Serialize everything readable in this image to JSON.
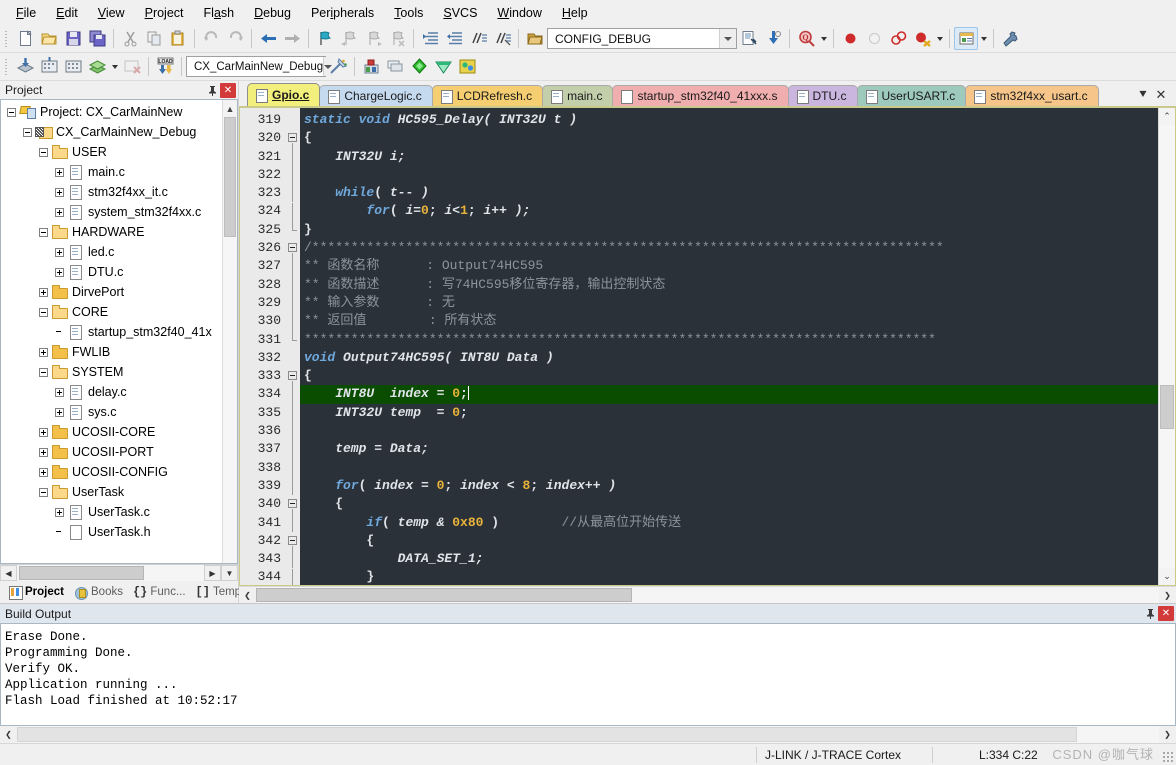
{
  "menubar": {
    "items": [
      {
        "label": "File",
        "accel": "F"
      },
      {
        "label": "Edit",
        "accel": "E"
      },
      {
        "label": "View",
        "accel": "V"
      },
      {
        "label": "Project",
        "accel": "P"
      },
      {
        "label": "Flash",
        "accel": "a"
      },
      {
        "label": "Debug",
        "accel": "D"
      },
      {
        "label": "Peripherals",
        "accel": "i"
      },
      {
        "label": "Tools",
        "accel": "T"
      },
      {
        "label": "SVCS",
        "accel": "S"
      },
      {
        "label": "Window",
        "accel": "W"
      },
      {
        "label": "Help",
        "accel": "H"
      }
    ]
  },
  "toolbar_main": {
    "config_value": "CONFIG_DEBUG",
    "icons": [
      "new-file-icon",
      "open-file-icon",
      "save-icon",
      "save-all-icon",
      "cut-icon",
      "copy-icon",
      "paste-icon",
      "undo-icon",
      "redo-icon",
      "navigate-back-icon",
      "navigate-forward-icon",
      "bookmark-toggle-icon",
      "bookmark-prev-icon",
      "bookmark-next-icon",
      "bookmark-clear-icon",
      "indent-icon",
      "outdent-icon",
      "comment-icon",
      "uncomment-icon",
      "open-config-icon",
      "build-target-file-icon",
      "download-icon",
      "find-in-files-icon",
      "insert-breakpoint-icon",
      "disable-breakpoint-icon",
      "kill-all-breakpoints-icon",
      "disable-all-breakpoints-icon",
      "manage-windows-icon",
      "configure-tools-icon"
    ]
  },
  "toolbar_build": {
    "target_value": "CX_CarMainNew_Debug",
    "icons": [
      "translate-icon",
      "build-icon",
      "rebuild-icon",
      "batch-build-icon",
      "stop-build-icon",
      "download-load-icon",
      "target-options-icon",
      "manage-project-items-icon",
      "multi-project-icon",
      "pack-installer-icon",
      "cube-mx-icon"
    ]
  },
  "project_pane": {
    "title": "Project",
    "pin_icon": "pin-icon",
    "close_icon": "close-icon",
    "tree": [
      {
        "depth": 0,
        "label": "Project: CX_CarMainNew",
        "icon": "project-icon",
        "expander": "minus"
      },
      {
        "depth": 1,
        "label": "CX_CarMainNew_Debug",
        "icon": "target-icon",
        "expander": "minus"
      },
      {
        "depth": 2,
        "label": "USER",
        "icon": "folder-open-icon",
        "expander": "minus"
      },
      {
        "depth": 3,
        "label": "main.c",
        "icon": "file-icon",
        "expander": "plus"
      },
      {
        "depth": 3,
        "label": "stm32f4xx_it.c",
        "icon": "file-icon",
        "expander": "plus"
      },
      {
        "depth": 3,
        "label": "system_stm32f4xx.c",
        "icon": "file-icon",
        "expander": "plus"
      },
      {
        "depth": 2,
        "label": "HARDWARE",
        "icon": "folder-open-icon",
        "expander": "minus"
      },
      {
        "depth": 3,
        "label": "led.c",
        "icon": "file-icon",
        "expander": "plus"
      },
      {
        "depth": 3,
        "label": "DTU.c",
        "icon": "file-icon",
        "expander": "plus"
      },
      {
        "depth": 2,
        "label": "DirvePort",
        "icon": "folder-closed-icon",
        "expander": "plus"
      },
      {
        "depth": 2,
        "label": "CORE",
        "icon": "folder-open-icon",
        "expander": "minus"
      },
      {
        "depth": 3,
        "label": "startup_stm32f40_41x",
        "icon": "file-icon",
        "expander": "none"
      },
      {
        "depth": 2,
        "label": "FWLIB",
        "icon": "folder-closed-icon",
        "expander": "plus"
      },
      {
        "depth": 2,
        "label": "SYSTEM",
        "icon": "folder-open-icon",
        "expander": "minus"
      },
      {
        "depth": 3,
        "label": "delay.c",
        "icon": "file-icon",
        "expander": "plus"
      },
      {
        "depth": 3,
        "label": "sys.c",
        "icon": "file-icon",
        "expander": "plus"
      },
      {
        "depth": 2,
        "label": "UCOSII-CORE",
        "icon": "folder-closed-icon",
        "expander": "plus"
      },
      {
        "depth": 2,
        "label": "UCOSII-PORT",
        "icon": "folder-closed-icon",
        "expander": "plus"
      },
      {
        "depth": 2,
        "label": "UCOSII-CONFIG",
        "icon": "folder-closed-icon",
        "expander": "plus"
      },
      {
        "depth": 2,
        "label": "UserTask",
        "icon": "folder-open-icon",
        "expander": "minus"
      },
      {
        "depth": 3,
        "label": "UserTask.c",
        "icon": "file-icon",
        "expander": "plus"
      },
      {
        "depth": 3,
        "label": "UserTask.h",
        "icon": "file-blank-icon",
        "expander": "none"
      }
    ],
    "bottom_tabs": [
      {
        "label": "Project",
        "icon": "project-tab-icon",
        "selected": true
      },
      {
        "label": "Books",
        "icon": "books-tab-icon",
        "selected": false
      },
      {
        "label": "Func...",
        "icon": "functions-tab-icon",
        "selected": false
      },
      {
        "label": "Temp...",
        "icon": "templates-tab-icon",
        "selected": false
      }
    ]
  },
  "editor": {
    "tabs": [
      {
        "label": "Gpio.c",
        "color": "#f3ef7d",
        "selected": true,
        "icon": "file-icon"
      },
      {
        "label": "ChargeLogic.c",
        "color": "#c5d9ef",
        "selected": false,
        "icon": "file-icon"
      },
      {
        "label": "LCDRefresh.c",
        "color": "#f5ce72",
        "selected": false,
        "icon": "file-icon"
      },
      {
        "label": "main.c",
        "color": "#c3ceab",
        "selected": false,
        "icon": "file-icon"
      },
      {
        "label": "startup_stm32f40_41xxx.s",
        "color": "#f0aeae",
        "selected": false,
        "icon": "file-blank-icon"
      },
      {
        "label": "DTU.c",
        "color": "#cbb6e0",
        "selected": false,
        "icon": "file-icon"
      },
      {
        "label": "UserUSART.c",
        "color": "#9ec9bd",
        "selected": false,
        "icon": "file-icon"
      },
      {
        "label": "stm32f4xx_usart.c",
        "color": "#f5c58a",
        "selected": false,
        "icon": "file-icon"
      }
    ],
    "tab_overflow_icon": "tab-list-icon",
    "tab_close_icon": "close-icon",
    "first_line_number": 319,
    "highlighted_line": 334,
    "lines": [
      {
        "n": 319,
        "fold": "none",
        "tokens": [
          {
            "t": "static ",
            "c": "kw"
          },
          {
            "t": "void ",
            "c": "kw"
          },
          {
            "t": "HC595_Delay( ",
            "c": "fn"
          },
          {
            "t": "INT32U ",
            "c": "ty"
          },
          {
            "t": "t )",
            "c": "ty"
          }
        ]
      },
      {
        "n": 320,
        "fold": "start",
        "tokens": [
          {
            "t": "{",
            "c": "pl"
          }
        ]
      },
      {
        "n": 321,
        "fold": "bar",
        "tokens": [
          {
            "t": "    INT32U i;",
            "c": "ty"
          }
        ]
      },
      {
        "n": 322,
        "fold": "bar",
        "tokens": [
          {
            "t": "",
            "c": "pl"
          }
        ]
      },
      {
        "n": 323,
        "fold": "bar",
        "tokens": [
          {
            "t": "    ",
            "c": "pl"
          },
          {
            "t": "while",
            "c": "kw"
          },
          {
            "t": "( ",
            "c": "pl"
          },
          {
            "t": "t-- )",
            "c": "ty"
          }
        ]
      },
      {
        "n": 324,
        "fold": "bar",
        "tokens": [
          {
            "t": "        ",
            "c": "pl"
          },
          {
            "t": "for",
            "c": "kw"
          },
          {
            "t": "( ",
            "c": "pl"
          },
          {
            "t": "i=",
            "c": "ty"
          },
          {
            "t": "0",
            "c": "num"
          },
          {
            "t": "; ",
            "c": "pl"
          },
          {
            "t": "i<",
            "c": "ty"
          },
          {
            "t": "1",
            "c": "num"
          },
          {
            "t": "; ",
            "c": "pl"
          },
          {
            "t": "i++ );",
            "c": "ty"
          }
        ]
      },
      {
        "n": 325,
        "fold": "end",
        "tokens": [
          {
            "t": "}",
            "c": "pl"
          }
        ]
      },
      {
        "n": 326,
        "fold": "start",
        "tokens": [
          {
            "t": "/*********************************************************************************",
            "c": "cm"
          }
        ]
      },
      {
        "n": 327,
        "fold": "bar",
        "tokens": [
          {
            "t": "** 函数名称      : Output74HC595",
            "c": "cm"
          }
        ]
      },
      {
        "n": 328,
        "fold": "bar",
        "tokens": [
          {
            "t": "** 函数描述      : 写74HC595移位寄存器，输出控制状态",
            "c": "cm"
          }
        ]
      },
      {
        "n": 329,
        "fold": "bar",
        "tokens": [
          {
            "t": "** 输入参数      : 无",
            "c": "cm"
          }
        ]
      },
      {
        "n": 330,
        "fold": "bar",
        "tokens": [
          {
            "t": "** 返回值        : 所有状态",
            "c": "cm"
          }
        ]
      },
      {
        "n": 331,
        "fold": "end",
        "tokens": [
          {
            "t": "*********************************************************************************",
            "c": "cm"
          }
        ]
      },
      {
        "n": 332,
        "fold": "none",
        "tokens": [
          {
            "t": "void ",
            "c": "kw"
          },
          {
            "t": "Output74HC595( ",
            "c": "fn"
          },
          {
            "t": "INT8U ",
            "c": "ty"
          },
          {
            "t": "Data )",
            "c": "ty"
          }
        ]
      },
      {
        "n": 333,
        "fold": "start",
        "tokens": [
          {
            "t": "{",
            "c": "pl"
          }
        ]
      },
      {
        "n": 334,
        "fold": "bar",
        "tokens": [
          {
            "t": "    INT8U  index = ",
            "c": "ty"
          },
          {
            "t": "0",
            "c": "num"
          },
          {
            "t": ";",
            "c": "pl"
          }
        ]
      },
      {
        "n": 335,
        "fold": "bar",
        "tokens": [
          {
            "t": "    INT32U temp  = ",
            "c": "ty"
          },
          {
            "t": "0",
            "c": "num"
          },
          {
            "t": ";",
            "c": "pl"
          }
        ]
      },
      {
        "n": 336,
        "fold": "bar",
        "tokens": [
          {
            "t": "",
            "c": "pl"
          }
        ]
      },
      {
        "n": 337,
        "fold": "bar",
        "tokens": [
          {
            "t": "    temp = Data;",
            "c": "ty"
          }
        ]
      },
      {
        "n": 338,
        "fold": "bar",
        "tokens": [
          {
            "t": "",
            "c": "pl"
          }
        ]
      },
      {
        "n": 339,
        "fold": "bar",
        "tokens": [
          {
            "t": "    ",
            "c": "pl"
          },
          {
            "t": "for",
            "c": "kw"
          },
          {
            "t": "( ",
            "c": "pl"
          },
          {
            "t": "index = ",
            "c": "ty"
          },
          {
            "t": "0",
            "c": "num"
          },
          {
            "t": "; ",
            "c": "pl"
          },
          {
            "t": "index < ",
            "c": "ty"
          },
          {
            "t": "8",
            "c": "num"
          },
          {
            "t": "; ",
            "c": "pl"
          },
          {
            "t": "index++ )",
            "c": "ty"
          }
        ]
      },
      {
        "n": 340,
        "fold": "start",
        "tokens": [
          {
            "t": "    {",
            "c": "pl"
          }
        ]
      },
      {
        "n": 341,
        "fold": "bar",
        "tokens": [
          {
            "t": "        ",
            "c": "pl"
          },
          {
            "t": "if",
            "c": "kw"
          },
          {
            "t": "( ",
            "c": "pl"
          },
          {
            "t": "temp & ",
            "c": "ty"
          },
          {
            "t": "0x80",
            "c": "num"
          },
          {
            "t": " )        ",
            "c": "pl"
          },
          {
            "t": "//从最高位开始传送",
            "c": "cm"
          }
        ]
      },
      {
        "n": 342,
        "fold": "start",
        "tokens": [
          {
            "t": "        {",
            "c": "pl"
          }
        ]
      },
      {
        "n": 343,
        "fold": "bar",
        "tokens": [
          {
            "t": "            DATA_SET_1;",
            "c": "ty"
          }
        ]
      },
      {
        "n": 344,
        "fold": "bar",
        "tokens": [
          {
            "t": "        }",
            "c": "pl"
          }
        ]
      }
    ]
  },
  "build_output": {
    "title": "Build Output",
    "pin_icon": "pin-icon",
    "close_icon": "close-icon",
    "text": "Erase Done.\nProgramming Done.\nVerify OK.\nApplication running ...\nFlash Load finished at 10:52:17"
  },
  "statusbar": {
    "debugger": "J-LINK / J-TRACE Cortex",
    "cursor_position": "L:334 C:22",
    "watermark": "CSDN @咖气球"
  },
  "colors": {
    "editor_bg": "#2b3138",
    "highlight_line": "#0b4d00",
    "accent": "#c9c98a",
    "gutter_bg": "#eaeaea"
  }
}
